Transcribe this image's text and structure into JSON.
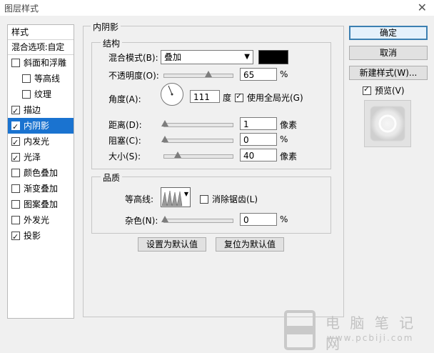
{
  "window": {
    "title": "图层样式",
    "close_glyph": "✕"
  },
  "style_list": {
    "header": "样式",
    "blend_options": "混合选项:自定",
    "items": [
      {
        "label": "斜面和浮雕",
        "checked": false,
        "indent": false,
        "selected": false
      },
      {
        "label": "等高线",
        "checked": false,
        "indent": true,
        "selected": false
      },
      {
        "label": "纹理",
        "checked": false,
        "indent": true,
        "selected": false
      },
      {
        "label": "描边",
        "checked": true,
        "indent": false,
        "selected": false
      },
      {
        "label": "内阴影",
        "checked": true,
        "indent": false,
        "selected": true
      },
      {
        "label": "内发光",
        "checked": true,
        "indent": false,
        "selected": false
      },
      {
        "label": "光泽",
        "checked": true,
        "indent": false,
        "selected": false
      },
      {
        "label": "颜色叠加",
        "checked": false,
        "indent": false,
        "selected": false
      },
      {
        "label": "渐变叠加",
        "checked": false,
        "indent": false,
        "selected": false
      },
      {
        "label": "图案叠加",
        "checked": false,
        "indent": false,
        "selected": false
      },
      {
        "label": "外发光",
        "checked": false,
        "indent": false,
        "selected": false
      },
      {
        "label": "投影",
        "checked": true,
        "indent": false,
        "selected": false
      }
    ]
  },
  "panel": {
    "title": "内阴影",
    "structure": {
      "title": "结构",
      "blend_mode_label": "混合模式(B):",
      "blend_mode_value": "叠加",
      "blend_color": "#000000",
      "opacity_label": "不透明度(O):",
      "opacity_value": "65",
      "opacity_unit": "%",
      "angle_label": "角度(A):",
      "angle_value": "111",
      "angle_unit": "度",
      "global_light_label": "使用全局光(G)",
      "global_light_checked": true,
      "distance_label": "距离(D):",
      "distance_value": "1",
      "distance_unit": "像素",
      "choke_label": "阻塞(C):",
      "choke_value": "0",
      "choke_unit": "%",
      "size_label": "大小(S):",
      "size_value": "40",
      "size_unit": "像素"
    },
    "quality": {
      "title": "品质",
      "contour_label": "等高线:",
      "anti_alias_label": "消除锯齿(L)",
      "anti_alias_checked": false,
      "noise_label": "杂色(N):",
      "noise_value": "0",
      "noise_unit": "%"
    },
    "make_default": "设置为默认值",
    "reset_default": "复位为默认值"
  },
  "right": {
    "ok": "确定",
    "cancel": "取消",
    "new_style": "新建样式(W)...",
    "preview_label": "预览(V)",
    "preview_checked": true
  },
  "watermark": {
    "name": "电 脑 笔 记 网",
    "url": "www.pcbiji.com"
  }
}
